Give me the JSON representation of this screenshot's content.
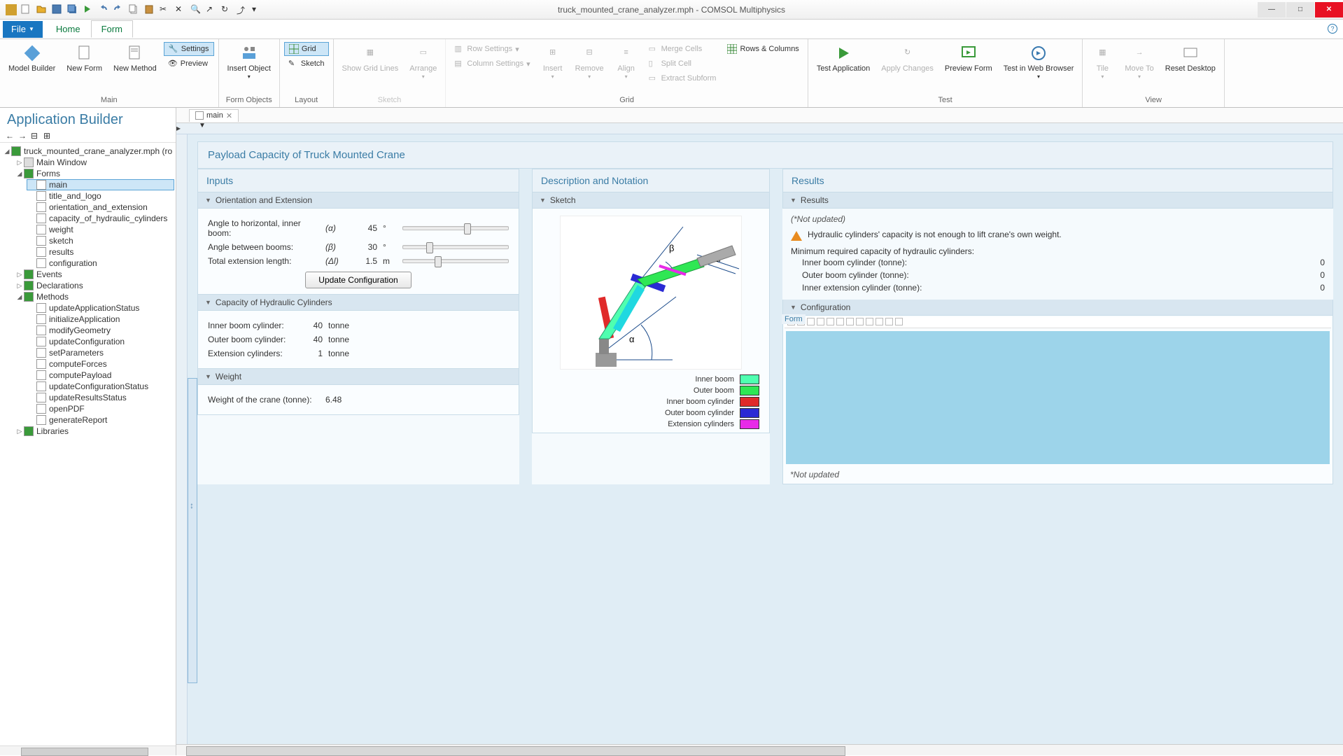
{
  "titlebar": {
    "title": "truck_mounted_crane_analyzer.mph - COMSOL Multiphysics"
  },
  "menu": {
    "file": "File",
    "tabs": [
      "Home",
      "Form"
    ],
    "active_tab": 1
  },
  "ribbon": {
    "main": {
      "label": "Main",
      "model_builder": "Model Builder",
      "new_form": "New Form",
      "new_method": "New Method",
      "settings": "Settings",
      "preview": "Preview"
    },
    "form_objects": {
      "label": "Form Objects",
      "insert_object": "Insert Object"
    },
    "layout": {
      "label": "Layout",
      "grid": "Grid",
      "sketch": "Sketch"
    },
    "sketch": {
      "label": "Sketch",
      "show_grid": "Show Grid Lines",
      "arrange": "Arrange"
    },
    "grid": {
      "label": "Grid",
      "row_settings": "Row Settings",
      "col_settings": "Column Settings",
      "insert": "Insert",
      "remove": "Remove",
      "align": "Align",
      "merge": "Merge Cells",
      "split": "Split Cell",
      "extract": "Extract Subform",
      "rows_cols": "Rows & Columns"
    },
    "test": {
      "label": "Test",
      "test_app": "Test Application",
      "apply": "Apply Changes",
      "preview_form": "Preview Form",
      "browser": "Test in Web Browser"
    },
    "view": {
      "label": "View",
      "tile": "Tile",
      "move_to": "Move To",
      "reset": "Reset Desktop"
    }
  },
  "app_builder": {
    "title": "Application Builder",
    "root": "truck_mounted_crane_analyzer.mph (ro",
    "nodes": {
      "main_window": "Main Window",
      "forms": "Forms",
      "forms_children": [
        "main",
        "title_and_logo",
        "orientation_and_extension",
        "capacity_of_hydraulic_cylinders",
        "weight",
        "sketch",
        "results",
        "configuration"
      ],
      "events": "Events",
      "declarations": "Declarations",
      "methods": "Methods",
      "methods_children": [
        "updateApplicationStatus",
        "initializeApplication",
        "modifyGeometry",
        "updateConfiguration",
        "setParameters",
        "computeForces",
        "computePayload",
        "updateConfigurationStatus",
        "updateResultsStatus",
        "openPDF",
        "generateReport"
      ],
      "libraries": "Libraries"
    },
    "selected": "main"
  },
  "doc_tab": "main",
  "form": {
    "page_title": "Payload Capacity of Truck Mounted Crane",
    "inputs": {
      "title": "Inputs",
      "orientation": {
        "title": "Orientation and Extension",
        "rows": [
          {
            "label": "Angle to horizontal, inner boom:",
            "sym": "(α)",
            "val": "45",
            "unit": "°",
            "thumb": 58
          },
          {
            "label": "Angle between booms:",
            "sym": "(β)",
            "val": "30",
            "unit": "°",
            "thumb": 22
          },
          {
            "label": "Total extension length:",
            "sym": "(Δl)",
            "val": "1.5",
            "unit": "m",
            "thumb": 30
          }
        ],
        "update": "Update Configuration"
      },
      "capacity": {
        "title": "Capacity of Hydraulic Cylinders",
        "rows": [
          {
            "label": "Inner boom cylinder:",
            "val": "40",
            "unit": "tonne"
          },
          {
            "label": "Outer boom cylinder:",
            "val": "40",
            "unit": "tonne"
          },
          {
            "label": "Extension cylinders:",
            "val": "1",
            "unit": "tonne"
          }
        ]
      },
      "weight": {
        "title": "Weight",
        "label": "Weight of the crane (tonne):",
        "val": "6.48"
      }
    },
    "desc": {
      "title": "Description and Notation",
      "sketch_title": "Sketch",
      "legend": [
        {
          "name": "Inner boom",
          "color": "#4fffb0"
        },
        {
          "name": "Outer boom",
          "color": "#2fe754"
        },
        {
          "name": "Inner boom cylinder",
          "color": "#e02a2a"
        },
        {
          "name": "Outer boom cylinder",
          "color": "#2a2ad4"
        },
        {
          "name": "Extension cylinders",
          "color": "#e82ae8"
        }
      ],
      "alpha": "α",
      "beta": "β",
      "delta": "Δl"
    },
    "results": {
      "title": "Results",
      "sub": "Results",
      "not_updated": "(*Not updated)",
      "warn": "Hydraulic cylinders' capacity is not enough to lift crane's own weight.",
      "min_req": "Minimum required capacity of hydraulic cylinders:",
      "rows": [
        {
          "label": "Inner boom cylinder (tonne):",
          "val": "0"
        },
        {
          "label": "Outer boom cylinder (tonne):",
          "val": "0"
        },
        {
          "label": "Inner extension cylinder (tonne):",
          "val": "0"
        }
      ],
      "config_title": "Configuration",
      "form_label": "Form",
      "not_updated2": "*Not updated"
    }
  },
  "settings_side": "Settings"
}
